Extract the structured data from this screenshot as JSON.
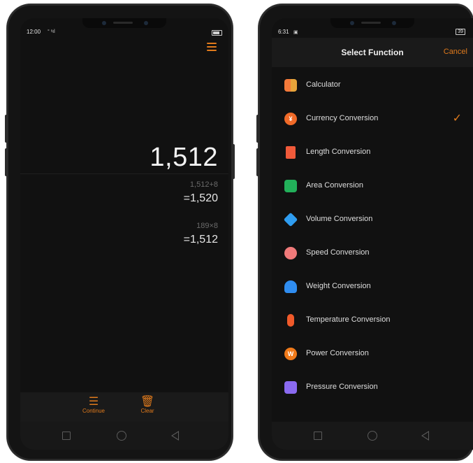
{
  "left_phone": {
    "status": {
      "time": "12:00",
      "signal": "° ˢıl"
    },
    "calculator": {
      "result": "1,512",
      "history": [
        {
          "expression": "1,512+8",
          "result": "=1,520"
        },
        {
          "expression": "189×8",
          "result": "=1,512"
        }
      ],
      "actions": {
        "continue_label": "Continue",
        "clear_label": "Clear"
      }
    }
  },
  "right_phone": {
    "status": {
      "time": "6:31",
      "battery": "39"
    },
    "header": {
      "title": "Select Function",
      "cancel_label": "Cancel"
    },
    "functions": [
      {
        "label": "Calculator",
        "icon": "calculator-icon",
        "selected": false
      },
      {
        "label": "Currency Conversion",
        "icon": "currency-icon",
        "selected": true
      },
      {
        "label": "Length Conversion",
        "icon": "ruler-icon",
        "selected": false
      },
      {
        "label": "Area Conversion",
        "icon": "area-icon",
        "selected": false
      },
      {
        "label": "Volume Conversion",
        "icon": "cube-icon",
        "selected": false
      },
      {
        "label": "Speed Conversion",
        "icon": "speedometer-icon",
        "selected": false
      },
      {
        "label": "Weight Conversion",
        "icon": "weight-icon",
        "selected": false
      },
      {
        "label": "Temperature Conversion",
        "icon": "thermometer-icon",
        "selected": false
      },
      {
        "label": "Power Conversion",
        "icon": "power-icon",
        "selected": false
      },
      {
        "label": "Pressure Conversion",
        "icon": "pressure-gauge-icon",
        "selected": false
      }
    ]
  },
  "colors": {
    "accent": "#e07a1c",
    "background": "#111111",
    "text": "#dedede"
  }
}
